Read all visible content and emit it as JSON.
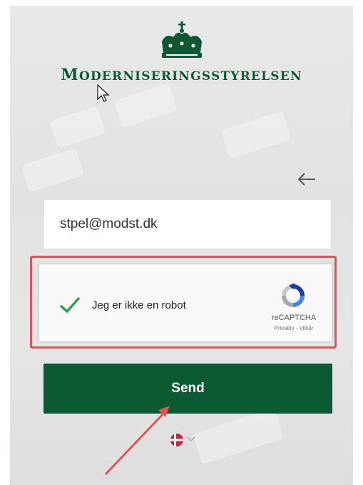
{
  "brand": {
    "name": "Moderniseringsstyrelsen",
    "first_letter": "M",
    "rest": "ODERNISERINGSSTYRELSEN"
  },
  "form": {
    "email_value": "stpel@modst.dk",
    "send_label": "Send"
  },
  "recaptcha": {
    "label": "Jeg er ikke en robot",
    "brand": "reCAPTCHA",
    "links": "Privatliv - Vilkår",
    "checked": true
  },
  "language": {
    "selected": "da",
    "flag": "denmark-flag"
  },
  "colors": {
    "brand_green": "#0b5a31",
    "checkmark_green": "#2e9e4f",
    "highlight_red": "#e05454",
    "panel_bg": "#e6e6e6"
  },
  "icons": [
    "crown-icon",
    "back-arrow-icon",
    "checkmark-icon",
    "recaptcha-logo-icon",
    "denmark-flag-icon",
    "chevron-down-icon",
    "cursor-icon",
    "annotation-arrow-icon"
  ]
}
